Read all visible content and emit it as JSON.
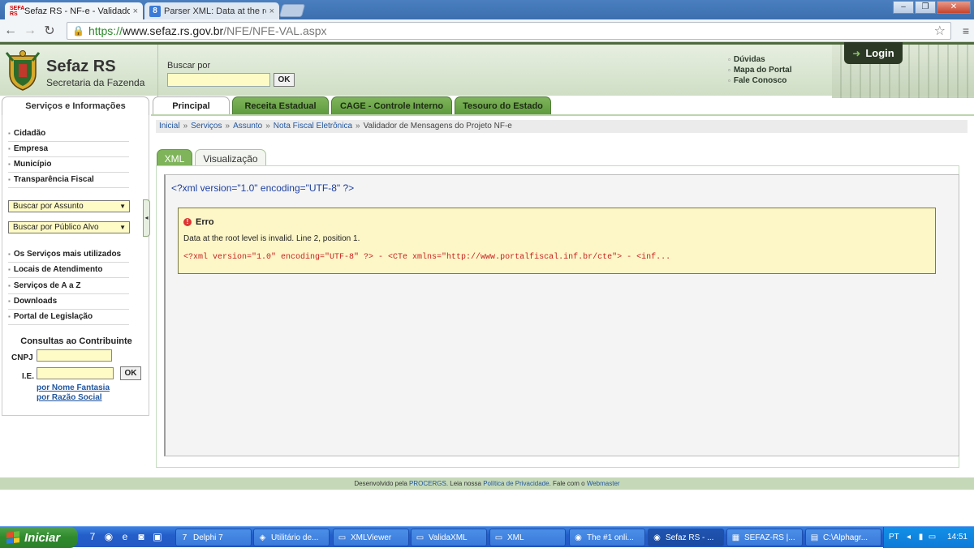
{
  "browser": {
    "tabs": [
      {
        "title": "Sefaz RS - NF-e - Validador d",
        "close": "×",
        "favicon": "sefaz-rs-favicon"
      },
      {
        "title": "Parser XML: Data at the root",
        "close": "×",
        "favicon": "google-favicon"
      }
    ],
    "address": {
      "scheme": "https://",
      "host": "www.sefaz.rs.gov.br",
      "path": "/NFE/NFE-VAL.aspx"
    },
    "window_buttons": {
      "minimize": "–",
      "maximize": "❐",
      "close": "✕"
    }
  },
  "header": {
    "site_name": "Sefaz RS",
    "site_sub": "Secretaria da Fazenda",
    "search_label": "Buscar por",
    "search_value": "",
    "search_button": "OK",
    "links": [
      "Dúvidas",
      "Mapa do Portal",
      "Fale Conosco"
    ],
    "login": "Login"
  },
  "nav": {
    "side_tab": "Serviços e Informações",
    "tabs": [
      "Principal",
      "Receita Estadual",
      "CAGE - Controle Interno",
      "Tesouro do Estado"
    ]
  },
  "sidebar": {
    "items_top": [
      "Cidadão",
      "Empresa",
      "Município",
      "Transparência Fiscal"
    ],
    "selects": [
      "Buscar por Assunto",
      "Buscar por Público Alvo"
    ],
    "items_bottom": [
      "Os Serviços mais utilizados",
      "Locais de Atendimento",
      "Serviços de A a Z",
      "Downloads",
      "Portal de Legislação"
    ],
    "consultas": {
      "heading": "Consultas ao Contribuinte",
      "cnpj_label": "CNPJ",
      "ie_label": "I.E.",
      "ok": "OK",
      "link1": "por Nome Fantasia",
      "link2": "por Razão Social"
    }
  },
  "breadcrumb": {
    "items": [
      "Inicial",
      "Serviços",
      "Assunto",
      "Nota Fiscal Eletrônica"
    ],
    "current": "Validador de Mensagens do Projeto NF-e",
    "separator": "»"
  },
  "content": {
    "subtabs": [
      "XML",
      "Visualização"
    ],
    "xml_declaration": "<?xml version=\"1.0\" encoding=\"UTF-8\" ?>",
    "error": {
      "title": "Erro",
      "message": "Data at the root level is invalid. Line 2, position 1.",
      "code": "<?xml version=\"1.0\" encoding=\"UTF-8\" ?> - <CTe xmlns=\"http://www.portalfiscal.inf.br/cte\"> - <inf..."
    }
  },
  "footer": {
    "prefix": "Desenvolvido pela",
    "procergs": "PROCERGS",
    "read": ". Leia nossa",
    "privacy": "Política de Privacidade",
    "contact_prefix": ". Fale com o",
    "webmaster": "Webmaster"
  },
  "taskbar": {
    "start": "Iniciar",
    "tasks": [
      "Delphi 7",
      "Utilitário de...",
      "XMLViewer",
      "ValidaXML",
      "XML",
      "The #1 onli...",
      "Sefaz RS - ...",
      "SEFAZ-RS |...",
      "C:\\Alphagr..."
    ],
    "language": "PT",
    "clock": "14:51"
  },
  "colors": {
    "accent_green": "#5d9a3d",
    "link_blue": "#22569e",
    "error_red": "#c81e1e",
    "error_bg": "#fdf7c8"
  }
}
